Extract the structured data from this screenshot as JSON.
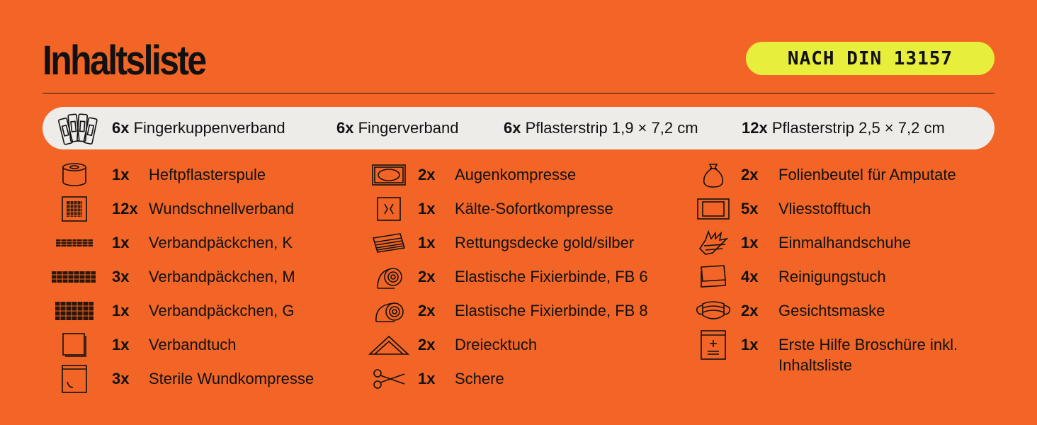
{
  "header": {
    "title": "Inhaltsliste",
    "badge": "NACH DIN 13157"
  },
  "strip": [
    {
      "qty": "6x",
      "name": "Fingerkuppenverband"
    },
    {
      "qty": "6x",
      "name": "Fingerverband"
    },
    {
      "qty": "6x",
      "name": "Pflasterstrip 1,9 × 7,2 cm"
    },
    {
      "qty": "12x",
      "name": "Pflasterstrip 2,5 × 7,2 cm"
    }
  ],
  "col1": [
    {
      "qty": "1x",
      "name": "Heftpflasterspule",
      "icon": "tape-roll-icon"
    },
    {
      "qty": "12x",
      "name": "Wundschnellverband",
      "icon": "gauze-pad-icon"
    },
    {
      "qty": "1x",
      "name": "Verbandpäckchen, K",
      "icon": "bandage-small-icon"
    },
    {
      "qty": "3x",
      "name": "Verbandpäckchen, M",
      "icon": "bandage-medium-icon"
    },
    {
      "qty": "1x",
      "name": "Verbandpäckchen, G",
      "icon": "bandage-large-icon"
    },
    {
      "qty": "1x",
      "name": "Verbandtuch",
      "icon": "cloth-icon"
    },
    {
      "qty": "3x",
      "name": "Sterile Wundkompresse",
      "icon": "sterile-pack-icon"
    }
  ],
  "col2": [
    {
      "qty": "2x",
      "name": "Augenkompresse",
      "icon": "eye-pad-icon"
    },
    {
      "qty": "1x",
      "name": "Kälte-Sofortkompresse",
      "icon": "cold-pack-icon"
    },
    {
      "qty": "1x",
      "name": "Rettungsdecke gold/silber",
      "icon": "rescue-blanket-icon"
    },
    {
      "qty": "2x",
      "name": "Elastische Fixierbinde, FB 6",
      "icon": "roll-bandage-6-icon"
    },
    {
      "qty": "2x",
      "name": "Elastische Fixierbinde, FB 8",
      "icon": "roll-bandage-8-icon"
    },
    {
      "qty": "2x",
      "name": "Dreiecktuch",
      "icon": "triangle-cloth-icon"
    },
    {
      "qty": "1x",
      "name": "Schere",
      "icon": "scissors-icon"
    }
  ],
  "col3": [
    {
      "qty": "2x",
      "name": "Folienbeutel für Amputate",
      "icon": "bag-icon"
    },
    {
      "qty": "5x",
      "name": "Vliesstofftuch",
      "icon": "fleece-cloth-icon"
    },
    {
      "qty": "1x",
      "name": "Einmalhandschuhe",
      "icon": "glove-icon"
    },
    {
      "qty": "4x",
      "name": "Reinigungstuch",
      "icon": "wipe-icon"
    },
    {
      "qty": "2x",
      "name": "Gesichtsmaske",
      "icon": "mask-icon"
    },
    {
      "qty": "1x",
      "name": "Erste Hilfe Broschüre inkl. Inhaltsliste",
      "icon": "brochure-icon"
    }
  ]
}
